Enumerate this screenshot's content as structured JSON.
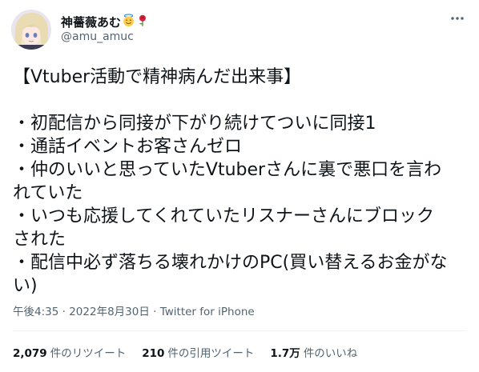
{
  "user": {
    "display_name": "神薔薇あむ",
    "handle": "@amu_amuc",
    "emojis": [
      "smiling-face-with-halo-emoji",
      "rose-emoji"
    ]
  },
  "tweet": {
    "lines": [
      "【Vtuber活動で精神病んだ出来事】",
      "",
      "・初配信から同接が下がり続けてついに同接1",
      "・通話イベントお客さんゼロ",
      "・仲のいいと思っていたVtuberさんに裏で悪口を言わ",
      "れていた",
      "・いつも応援してくれていたリスナーさんにブロック",
      "された",
      "・配信中必ず落ちる壊れかけのPC(買い替えるお金がな",
      "い)"
    ]
  },
  "meta": {
    "time": "午後4:35",
    "separator1": "·",
    "date": "2022年8月30日",
    "separator2": "·",
    "client": "Twitter for iPhone"
  },
  "stats": {
    "retweets_count": "2,079",
    "retweets_label": "件のリツイート",
    "quotes_count": "210",
    "quotes_label": "件の引用ツイート",
    "likes_count": "1.7万",
    "likes_label": "件のいいね"
  },
  "icons": {
    "more": "more-options-icon"
  },
  "colors": {
    "text_primary": "#0f1419",
    "text_secondary": "#536471",
    "divider": "#eff3f4"
  }
}
